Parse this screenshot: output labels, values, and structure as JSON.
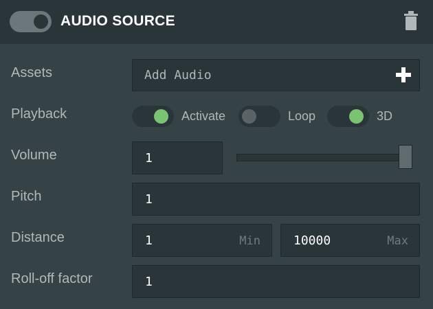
{
  "header": {
    "title": "AUDIO SOURCE",
    "enabled": true,
    "trash_icon": "trash-icon"
  },
  "assets": {
    "label": "Assets",
    "button_text": "Add Audio",
    "add_icon": "plus-icon"
  },
  "playback": {
    "label": "Playback",
    "toggles": [
      {
        "label": "Activate",
        "on": true
      },
      {
        "label": "Loop",
        "on": false
      },
      {
        "label": "3D",
        "on": true
      }
    ]
  },
  "volume": {
    "label": "Volume",
    "value": "1",
    "slider_fraction": 1.0
  },
  "pitch": {
    "label": "Pitch",
    "value": "1"
  },
  "distance": {
    "label": "Distance",
    "min_value": "1",
    "min_suffix": "Min",
    "max_value": "10000",
    "max_suffix": "Max"
  },
  "rolloff": {
    "label": "Roll-off factor",
    "value": "1"
  },
  "colors": {
    "header_bg": "#293538",
    "panel_bg": "#364346",
    "toggle_on": "#7ac471",
    "toggle_off": "#5a6467"
  }
}
